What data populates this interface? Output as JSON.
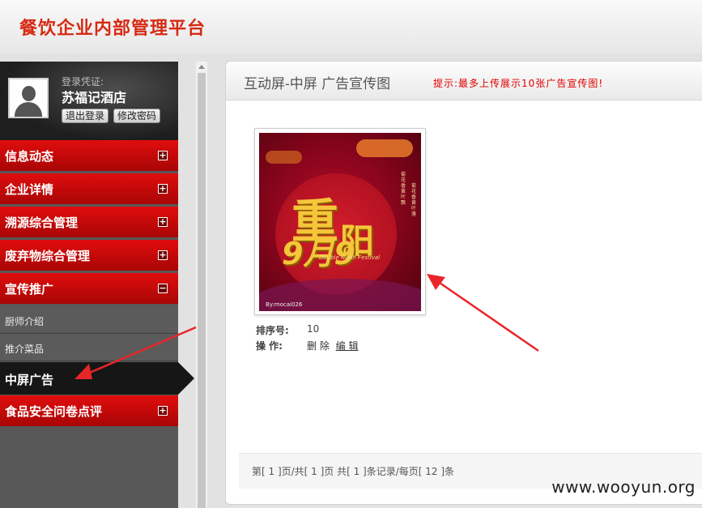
{
  "header": {
    "title": "餐饮企业内部管理平台"
  },
  "user": {
    "login_label": "登录凭证:",
    "name": "苏福记酒店",
    "logout_label": "退出登录",
    "change_password_label": "修改密码"
  },
  "sidebar": {
    "items": [
      {
        "label": "信息动态",
        "toggle": "+"
      },
      {
        "label": "企业详情",
        "toggle": "+"
      },
      {
        "label": "溯源综合管理",
        "toggle": "+"
      },
      {
        "label": "废弃物综合管理",
        "toggle": "+"
      },
      {
        "label": "宣传推广",
        "toggle": "−"
      },
      {
        "label": "食品安全问卷点评",
        "toggle": "+"
      }
    ],
    "sub_items": [
      {
        "label": "厨师介绍"
      },
      {
        "label": "推介菜品"
      },
      {
        "label": "中屏广告"
      }
    ]
  },
  "main": {
    "title": "互动屏-中屏 广告宣传图",
    "hint": "提示:最多上传展示10张广告宣传图!",
    "ad_image": {
      "main_chars": "重",
      "sub_chars": "阳",
      "date": "9月9",
      "english": "Double Ninth Festival",
      "poem_1": "菊花香 黄叶飘",
      "poem_2": "菊花香 黄叶落",
      "credit": "By:mocai026"
    },
    "sort_label": "排序号:",
    "sort_value": "10",
    "op_label": "操  作:",
    "delete_label": "删 除",
    "edit_label": "编 辑",
    "pagination": "第[ 1 ]页/共[ 1 ]页 共[ 1 ]条记录/每页[ 12 ]条"
  },
  "watermark": "www.wooyun.org",
  "colors": {
    "accent_red": "#d62a14",
    "nav_red": "#c80909",
    "hint_red": "#e00000"
  }
}
